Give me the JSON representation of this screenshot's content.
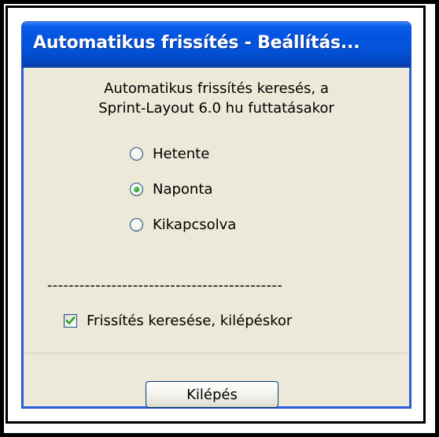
{
  "window": {
    "title": "Automatikus frissítés - Beállítás..."
  },
  "description": {
    "line1": "Automatikus frissítés keresés, a",
    "line2": "Sprint-Layout 6.0 hu futtatásakor"
  },
  "frequency": {
    "options": [
      {
        "label": "Hetente",
        "checked": false
      },
      {
        "label": "Naponta",
        "checked": true
      },
      {
        "label": "Kikapcsolva",
        "checked": false
      }
    ],
    "selected": "Naponta"
  },
  "separator_text": "--------------------------------------------",
  "exit_check": {
    "label": "Frissítés keresése, kilépéskor",
    "checked": true
  },
  "buttons": {
    "exit_label": "Kilépés"
  },
  "colors": {
    "titlebar": "#0454e2",
    "window_background": "#ece9d8",
    "radio_selected": "#21a121",
    "checkmark": "#21a121"
  }
}
